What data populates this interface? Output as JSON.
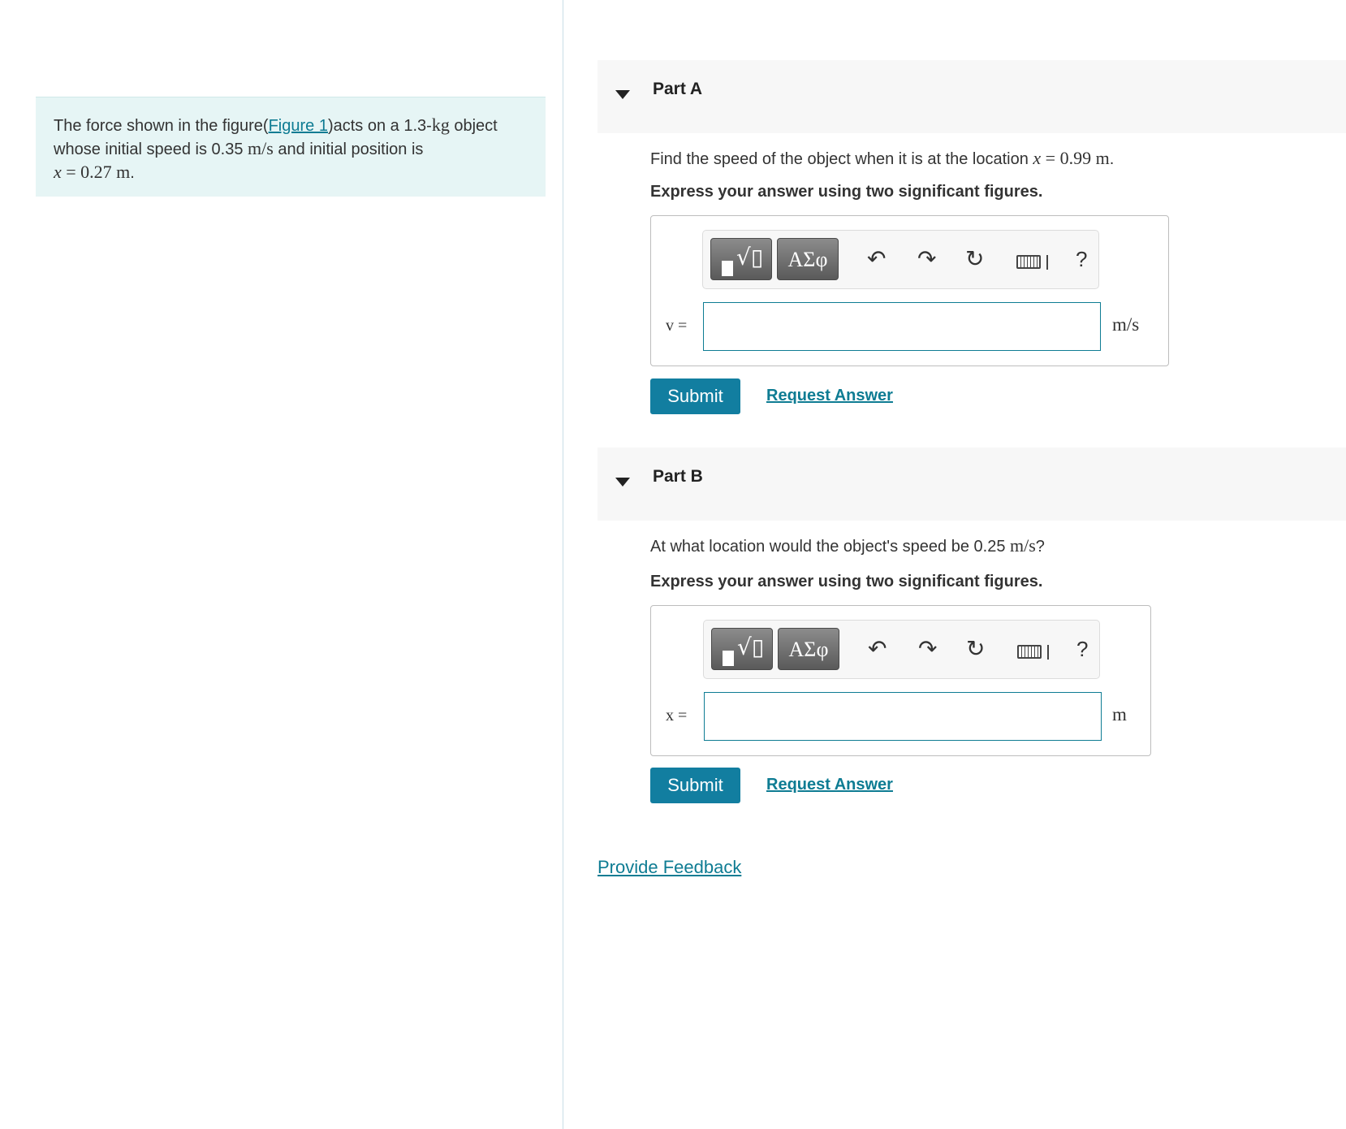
{
  "intro": {
    "text_before_link": "The force shown in the figure(",
    "figure_link": "Figure 1",
    "text_after_link": ")acts on a 1.3-",
    "mass_unit": "kg",
    "text_object": " object",
    "line2_before": "whose initial speed is 0.35 ",
    "speed_unit": "m/s",
    "line2_after": " and initial position is",
    "position_var": "x",
    "position_value": " = 0.27 m",
    "position_end": "."
  },
  "partA": {
    "title": "Part A",
    "question_text": "Find the speed of the object when it is at the location ",
    "question_var": "x",
    "question_math": " = 0.99 m",
    "question_end": ".",
    "instruction": "Express your answer using two significant figures.",
    "answer_label": "v =",
    "answer_value": "",
    "unit": "m/s",
    "submit_label": "Submit",
    "request_label": "Request Answer"
  },
  "partB": {
    "title": "Part B",
    "question_text": "At what location would the object's speed be 0.25 ",
    "question_unit": "m/s",
    "question_end": "?",
    "instruction": "Express your answer using two significant figures.",
    "answer_label": "x =",
    "answer_value": "",
    "unit": "m",
    "submit_label": "Submit",
    "request_label": "Request Answer"
  },
  "toolbar": {
    "greek_label": "ΑΣφ",
    "help_label": "?",
    "undo_glyph": "↶",
    "redo_glyph": "↷",
    "reset_glyph": "↻"
  },
  "feedback_link": "Provide Feedback",
  "colors": {
    "accent": "#0e7c93",
    "submit_bg": "#127ea0",
    "intro_bg": "#e6f5f5",
    "part_header_bg": "#f7f7f7"
  }
}
